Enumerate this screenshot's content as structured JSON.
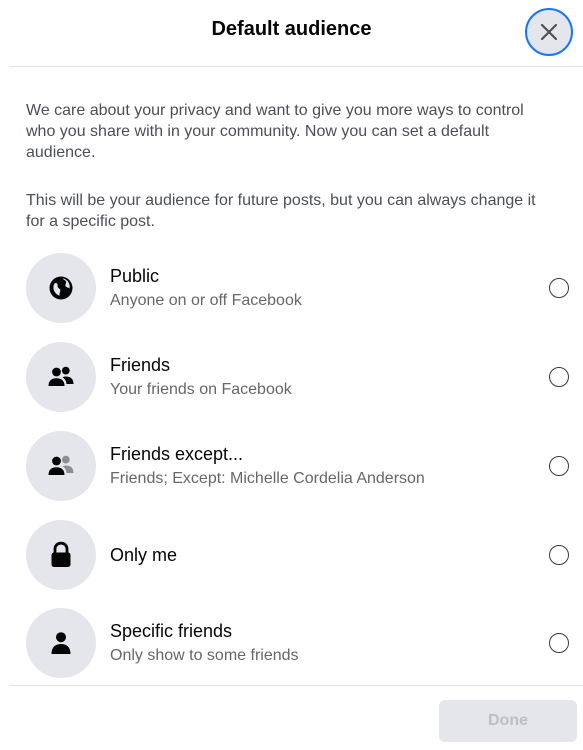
{
  "dialog": {
    "title": "Default audience",
    "close_icon": "close-icon",
    "intro_1": "We care about your privacy and want to give you more ways to control who you share with in your community. Now you can set a default audience.",
    "intro_2": "This will be your audience for future posts, but you can always change it for a specific post."
  },
  "options": [
    {
      "icon": "globe-icon",
      "title": "Public",
      "subtitle": "Anyone on or off Facebook",
      "selected": false
    },
    {
      "icon": "friends-icon",
      "title": "Friends",
      "subtitle": "Your friends on Facebook",
      "selected": false
    },
    {
      "icon": "friends-except-icon",
      "title": "Friends except...",
      "subtitle": "Friends; Except: Michelle Cordelia Anderson",
      "selected": false
    },
    {
      "icon": "lock-icon",
      "title": "Only me",
      "subtitle": "",
      "selected": false
    },
    {
      "icon": "person-icon",
      "title": "Specific friends",
      "subtitle": "Only show to some friends",
      "selected": false
    }
  ],
  "footer": {
    "done_label": "Done",
    "done_enabled": false
  },
  "colors": {
    "accent": "#1877f2",
    "icon_bg": "#e4e6eb",
    "text_primary": "#050505",
    "text_secondary": "#65676b",
    "button_disabled_bg": "#e4e6eb",
    "button_disabled_text": "#bcc0c4"
  }
}
